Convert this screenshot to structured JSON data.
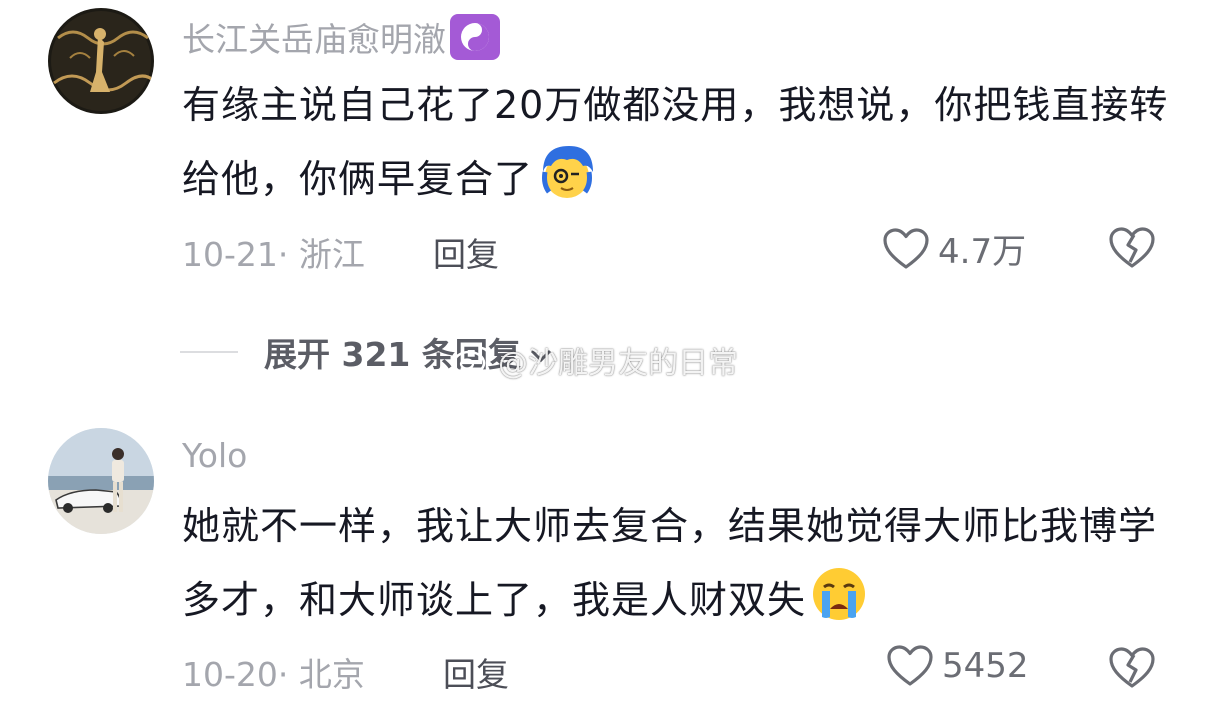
{
  "comments": [
    {
      "username": "长江关岳庙愈明澈",
      "badge_icon": "yin-yang-icon",
      "text": "有缘主说自己花了20万做都没用，我想说，你把钱直接转给他，你俩早复合了",
      "emoji_icon": "blue-hair-monocle-emoji-icon",
      "date_location": "10-21· 浙江",
      "reply_label": "回复",
      "likes": "4.7万"
    },
    {
      "username": "Yolo",
      "text": "她就不一样，我让大师去复合，结果她觉得大师比我博学多才，和大师谈上了，我是人财双失",
      "emoji_icon": "crying-face-emoji-icon",
      "date_location": "10-20· 北京",
      "reply_label": "回复",
      "likes": "5452"
    }
  ],
  "expand_replies_label": "展开 321 条回复",
  "watermark_text": "@沙雕男友的日常",
  "colors": {
    "secondary_text": "#a4a6ad",
    "main_text": "#161823",
    "badge_purple": "#a45ad6"
  }
}
